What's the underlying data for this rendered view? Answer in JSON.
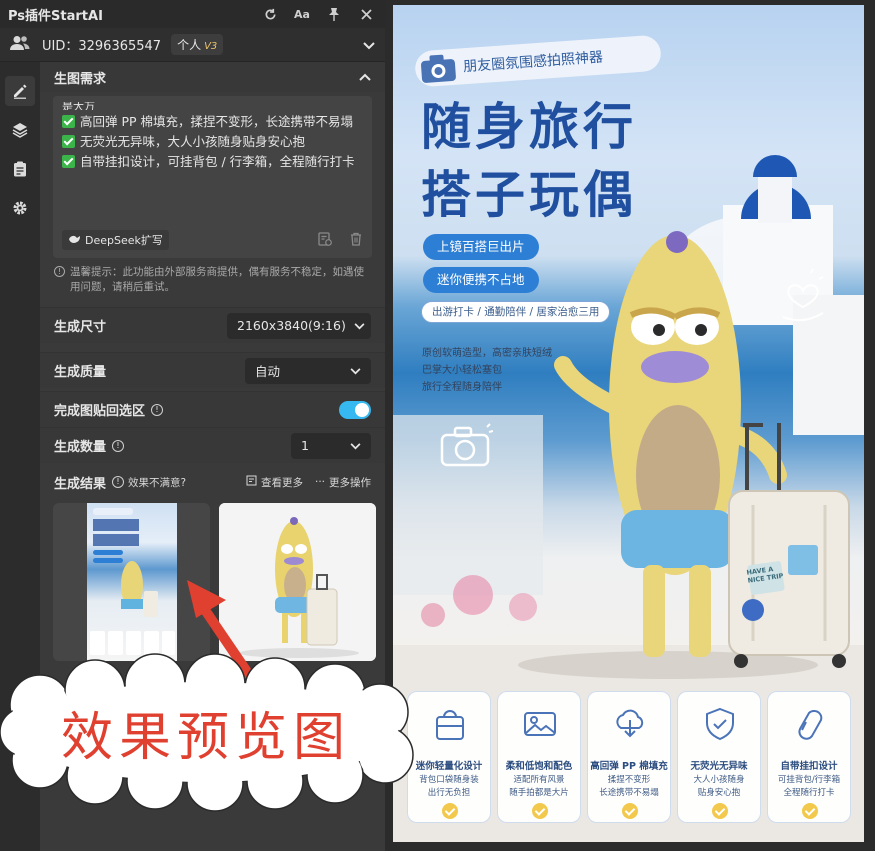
{
  "window": {
    "title": "Ps插件StartAI",
    "font_toggle_label": "Aa"
  },
  "user": {
    "uid": "UID：3296365547",
    "plan": "个人",
    "plan_version": "V3"
  },
  "requirement": {
    "section_title": "生图需求",
    "cut_line": "是大万",
    "bullets": [
      "高回弹 PP 棉填充，揉捏不变形，长途携带不易塌",
      "无荧光无异味，大人小孩随身贴身安心抱",
      "自带挂扣设计，可挂背包 / 行李箱，全程随行打卡"
    ],
    "deepseek_button": "DeepSeek扩写",
    "tip": "温馨提示：此功能由外部服务商提供，偶有服务不稳定，如遇使用问题，请稍后重试。"
  },
  "settings": {
    "size_label": "生成尺寸",
    "size_value": "2160x3840(9:16)",
    "quality_label": "生成质量",
    "quality_value": "自动",
    "paste_back_label": "完成图贴回选区",
    "paste_back_on": true,
    "count_label": "生成数量",
    "count_value": "1"
  },
  "results": {
    "title": "生成结果",
    "unsatisfied": "效果不满意?",
    "view_more": "查看更多",
    "more_actions": "更多操作"
  },
  "poster": {
    "tag": "朋友圈氛围感拍照神器",
    "headline_1": "随身旅行",
    "headline_2": "搭子玩偶",
    "pill_1": "上镜百搭巨出片",
    "pill_2": "迷你便携不占地",
    "pill_3": "出游打卡 / 通勤陪伴 / 居家治愈三用",
    "desc": [
      "原创软萌造型，高密亲肤短绒",
      "巴掌大小轻松塞包",
      "旅行全程随身陪伴"
    ],
    "sticker_text": "HAVE A NICE TRIP",
    "features": [
      {
        "title": "迷你轻量化设计",
        "desc": [
          "背包口袋随身装",
          "出行无负担"
        ],
        "icon": "bag-icon"
      },
      {
        "title": "柔和低饱和配色",
        "desc": [
          "适配所有风景",
          "随手拍都是大片"
        ],
        "icon": "picture-icon"
      },
      {
        "title": "高回弹 PP 棉填充",
        "desc": [
          "揉捏不变形",
          "长途携带不易塌"
        ],
        "icon": "cloud-icon"
      },
      {
        "title": "无荧光无异味",
        "desc": [
          "大人小孩随身",
          "贴身安心抱"
        ],
        "icon": "shield-icon"
      },
      {
        "title": "自带挂扣设计",
        "desc": [
          "可挂背包/行李箱",
          "全程随行打卡"
        ],
        "icon": "carabiner-icon"
      }
    ]
  },
  "callout": {
    "text": "效果预览图"
  },
  "colors": {
    "accent_blue": "#2d7fd6",
    "toggle_on": "#35b9f0",
    "callout_red": "#e0402f",
    "check_green": "#3bb54a"
  }
}
